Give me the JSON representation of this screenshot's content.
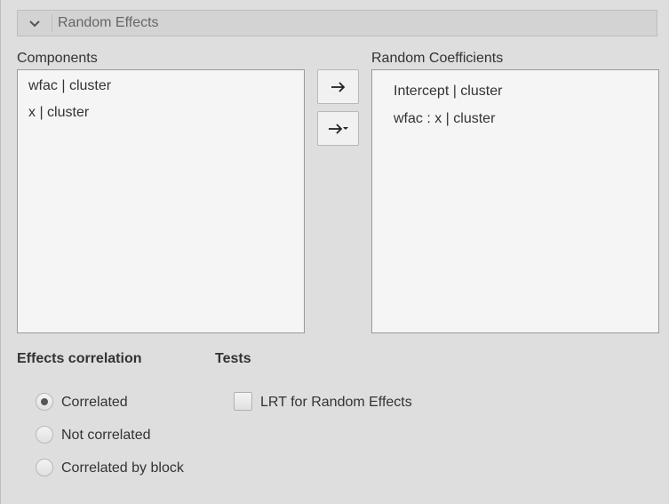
{
  "section": {
    "title": "Random Effects",
    "collapse_icon": "chevron-down-icon"
  },
  "components": {
    "label": "Components",
    "items": [
      "wfac | cluster",
      "x | cluster"
    ]
  },
  "random_coefficients": {
    "label": "Random Coefficients",
    "items": [
      "Intercept | cluster",
      "wfac : x | cluster"
    ]
  },
  "buttons": {
    "move_right_icon": "arrow-right-icon",
    "move_right_menu_icon": "arrow-right-dropdown-icon"
  },
  "effects_correlation": {
    "label": "Effects correlation",
    "options": [
      "Correlated",
      "Not correlated",
      "Correlated by block"
    ],
    "selected": "Correlated"
  },
  "tests": {
    "label": "Tests",
    "lrt_label": "LRT for Random Effects",
    "lrt_checked": false
  },
  "colors": {
    "background": "#dedede",
    "listbox": "#f5f5f5",
    "header": "#d3d3d3"
  }
}
